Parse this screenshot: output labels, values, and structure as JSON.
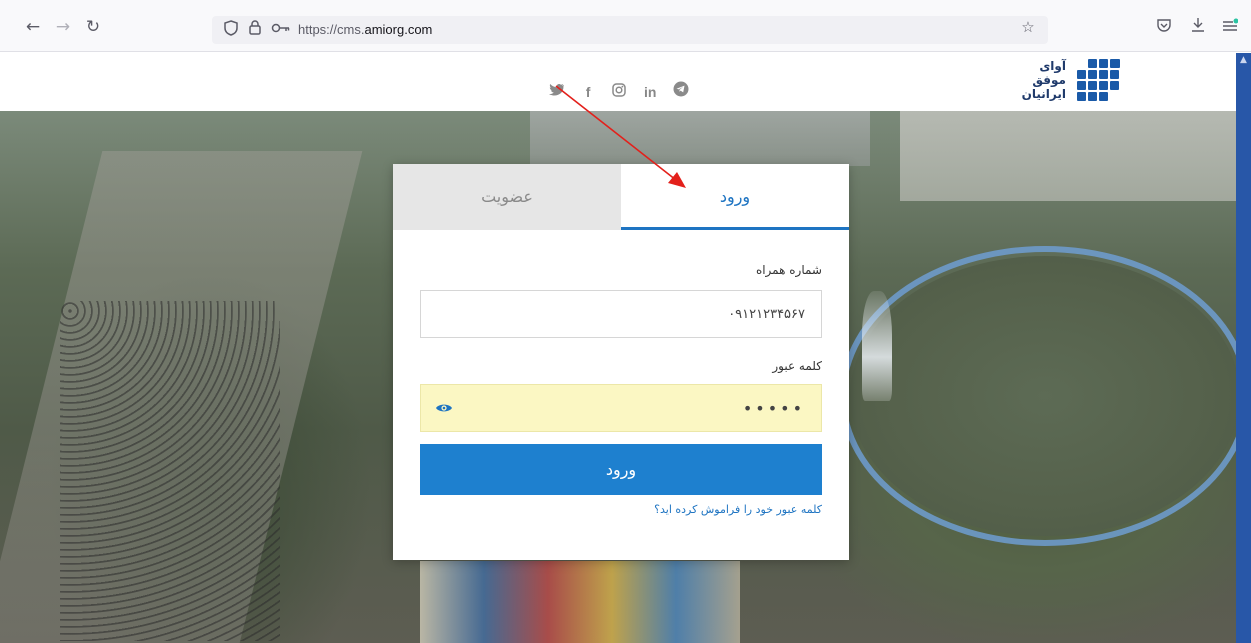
{
  "browser": {
    "url_prefix": "https://cms.",
    "url_host": "amiorg.com",
    "icons": {
      "back": "arrow-left-icon",
      "forward": "arrow-right-icon",
      "reload": "reload-icon",
      "shield": "shield-icon",
      "lock": "lock-icon",
      "permissions": "key-icon",
      "bookmark": "star-icon",
      "pocket": "pocket-icon",
      "download": "download-icon",
      "menu": "menu-icon"
    }
  },
  "header": {
    "social": [
      "twitter-icon",
      "facebook-icon",
      "instagram-icon",
      "linkedin-icon",
      "telegram-icon"
    ],
    "logo": {
      "line1": "آوای",
      "line2": "موفق",
      "line3": "ایرانیان",
      "color": "#1a5aa8"
    }
  },
  "login_card": {
    "tab_register": "عضویت",
    "tab_login": "ورود",
    "phone_label": "شماره همراه",
    "phone_value": "۰۹۱۲۱۲۳۴۵۶۷",
    "password_label": "کلمه عبور",
    "password_value": "•••••",
    "submit_label": "ورود",
    "forgot_link": "کلمه عبور خود را فراموش کرده اید؟",
    "accent_color": "#1e74c2"
  }
}
